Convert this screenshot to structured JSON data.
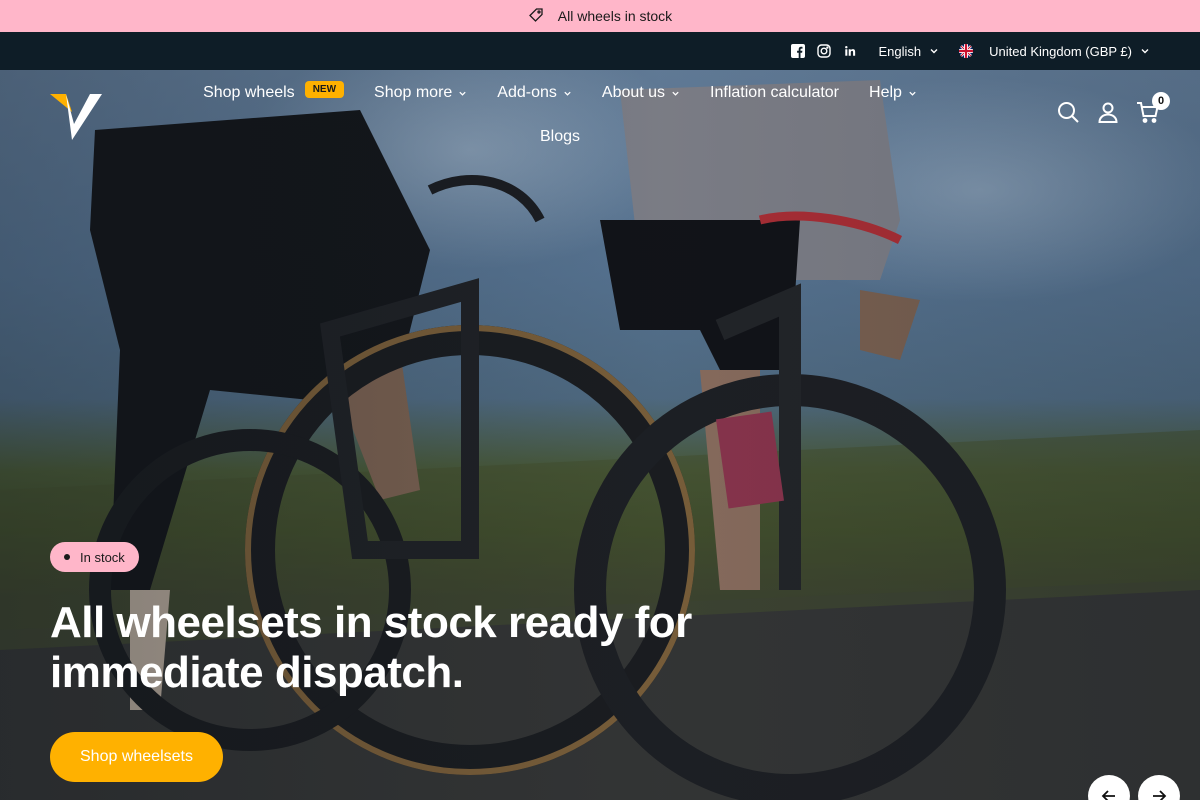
{
  "announcement": {
    "icon": "tag-icon",
    "text": "All wheels in stock"
  },
  "utility": {
    "social": [
      "facebook-icon",
      "instagram-icon",
      "linkedin-icon"
    ],
    "language": "English",
    "country": "United Kingdom (GBP £)"
  },
  "nav": {
    "row1": [
      {
        "label": "Shop wheels",
        "badge": "NEW",
        "dropdown": false
      },
      {
        "label": "Shop more",
        "dropdown": true
      },
      {
        "label": "Add-ons",
        "dropdown": true
      },
      {
        "label": "About us",
        "dropdown": true
      },
      {
        "label": "Inflation calculator",
        "dropdown": false
      },
      {
        "label": "Help",
        "dropdown": true
      }
    ],
    "row2": [
      {
        "label": "Blogs",
        "dropdown": false
      }
    ]
  },
  "header": {
    "cart_count": "0"
  },
  "hero": {
    "badge": "In stock",
    "headline_line1": "All wheelsets in stock ready for",
    "headline_line2": "immediate dispatch.",
    "cta": "Shop wheelsets"
  },
  "colors": {
    "announce": "#ffb6c9",
    "utility": "#0e1d27",
    "accent": "#ffb100"
  }
}
